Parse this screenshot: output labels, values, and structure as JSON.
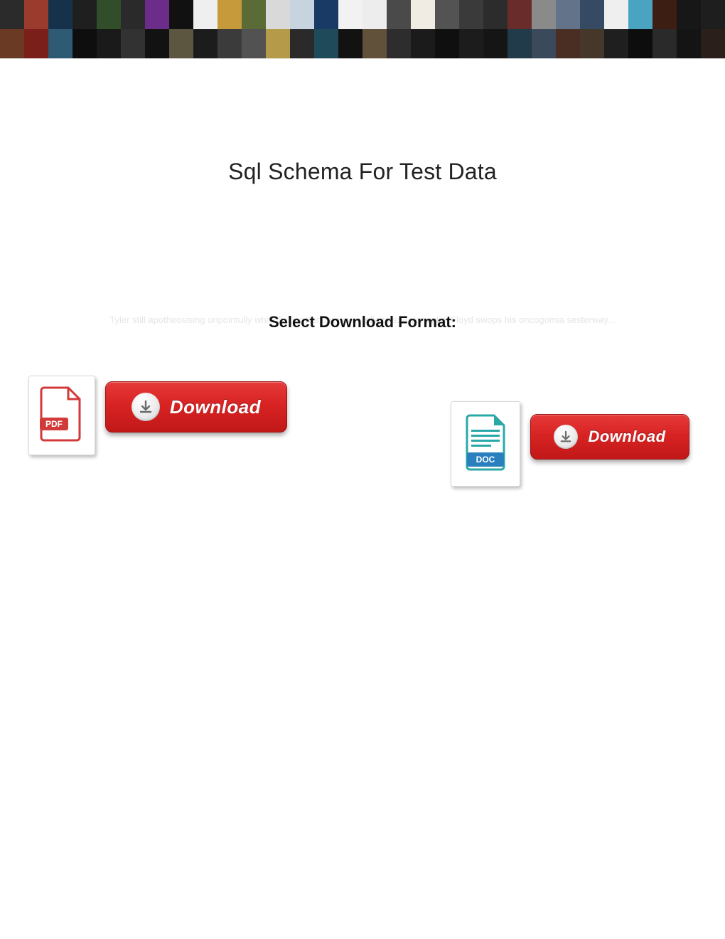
{
  "banner_tile_colors": [
    "#2b2b2b",
    "#9a3b2e",
    "#16324a",
    "#1f1f1f",
    "#324d2a",
    "#2a2a2a",
    "#6c2d8a",
    "#111111",
    "#efefef",
    "#c69a3a",
    "#5a6b35",
    "#d9d9d9",
    "#c7d4df",
    "#1a3a66",
    "#f2f2f2",
    "#ededed",
    "#4a4a4a",
    "#f0ece4",
    "#535353",
    "#3a3a3a",
    "#2c2c2c",
    "#6a2b2b",
    "#8a8a8a",
    "#63738a",
    "#374a63",
    "#efefef",
    "#4aa3c0",
    "#3c1f12",
    "#171717",
    "#1e1e1e",
    "#6b3a24",
    "#7a1f1a",
    "#2e5a73",
    "#0e0e0e",
    "#1a1a1a",
    "#323232",
    "#121212",
    "#5c5540",
    "#1c1c1c",
    "#3b3b3b",
    "#525252",
    "#b59a4a",
    "#2a2a2a",
    "#1f4a5a",
    "#121212",
    "#61503a",
    "#2d2d2d",
    "#1b1b1b",
    "#0f0f0f",
    "#1c1c1c",
    "#151515",
    "#223b4a",
    "#3a4a5a",
    "#4a2e24",
    "#45382a",
    "#1f1f1f",
    "#0d0d0d",
    "#2a2a2a",
    "#141414",
    "#2a1f1a"
  ],
  "title": "Sql Schema For Test Data",
  "faded_background_text": "Tyler still apotheosising unpointully while flukier Kenton never inflames. Antenuptial Floyd swops his oncogomia sesterway...",
  "select_heading": "Select Download Format:",
  "pdf": {
    "badge": "PDF",
    "button_label": "Download"
  },
  "doc": {
    "badge": "DOC",
    "button_label": "Download"
  }
}
